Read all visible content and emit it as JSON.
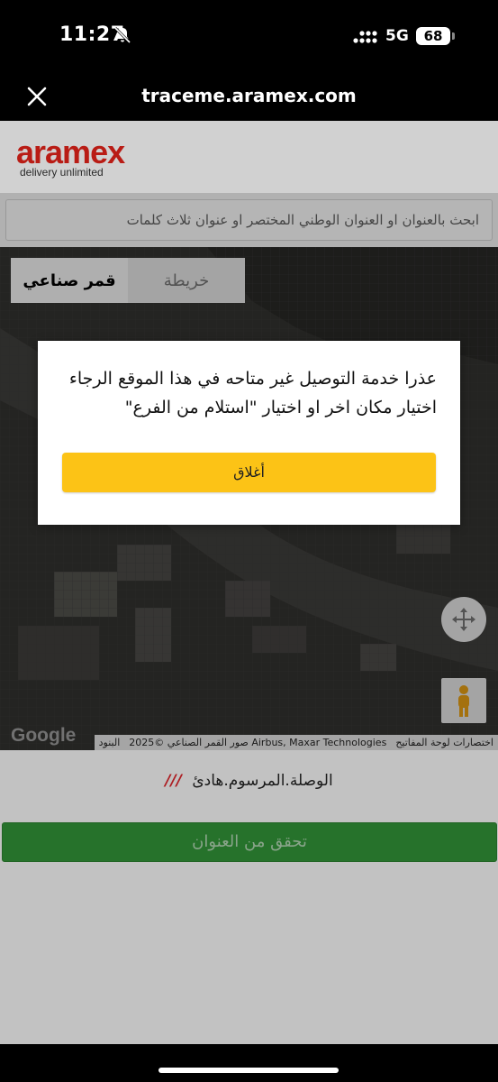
{
  "status_bar": {
    "time": "11:27",
    "network": "5G",
    "battery": "68",
    "icons": [
      "bell-slash-icon",
      "signal-dots-icon"
    ]
  },
  "browser": {
    "url": "traceme.aramex.com",
    "close_icon": "close-icon"
  },
  "brand": {
    "name": "aramex",
    "tagline": "delivery unlimited",
    "color": "#e2231a"
  },
  "search": {
    "placeholder": "ابحث بالعنوان او العنوان الوطني المختصر او عنوان ثلاث كلمات"
  },
  "map": {
    "type_options": [
      "خريطة",
      "قمر صناعي"
    ],
    "selected_type": "قمر صناعي",
    "provider": "Google",
    "attribution": {
      "shortcuts": "اختصارات لوحة المفاتيح",
      "imagery": "صور القمر الصناعي ©2025 Airbus, Maxar Technologies",
      "terms": "البنود"
    },
    "controls": [
      "locate-icon",
      "pegman-icon"
    ]
  },
  "location": {
    "slashes": "///",
    "words": "الوصلة.المرسوم.هادئ"
  },
  "check_button": {
    "label": "تحقق من العنوان",
    "color": "#2f8c35"
  },
  "modal": {
    "message": "عذرا خدمة التوصيل غير متاحه في هذا الموقع الرجاء اختيار مكان اخر او اختيار \"استلام من الفرع\"",
    "close_label": "أغلاق",
    "button_color": "#fcc316"
  }
}
